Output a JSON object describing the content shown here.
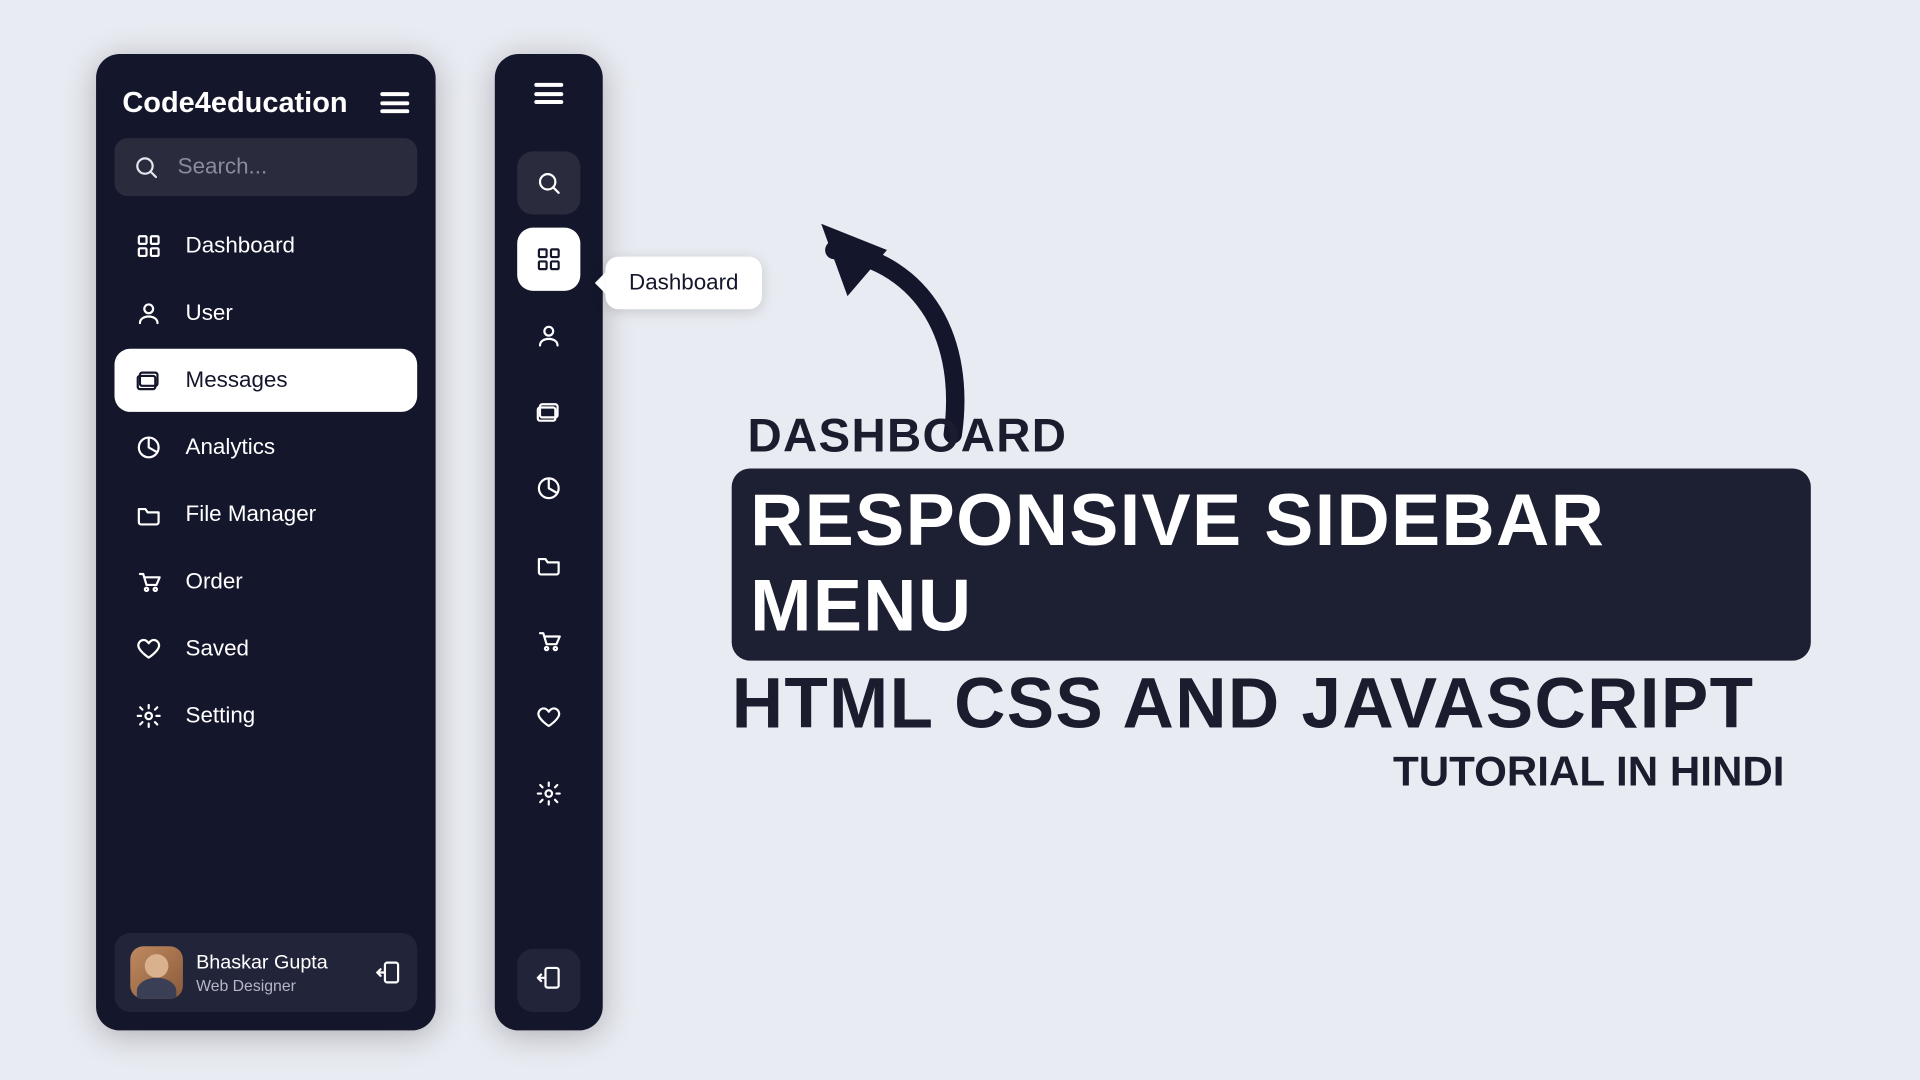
{
  "brand": "Code4education",
  "search": {
    "placeholder": "Search..."
  },
  "nav": {
    "items": [
      {
        "id": "dashboard",
        "label": "Dashboard"
      },
      {
        "id": "user",
        "label": "User"
      },
      {
        "id": "messages",
        "label": "Messages"
      },
      {
        "id": "analytics",
        "label": "Analytics"
      },
      {
        "id": "filemanager",
        "label": "File Manager"
      },
      {
        "id": "order",
        "label": "Order"
      },
      {
        "id": "saved",
        "label": "Saved"
      },
      {
        "id": "setting",
        "label": "Setting"
      }
    ],
    "active_expanded": "messages",
    "active_collapsed": "dashboard"
  },
  "tooltip": {
    "label": "Dashboard"
  },
  "user": {
    "name": "Bhaskar Gupta",
    "role": "Web Designer"
  },
  "headline": {
    "kicker": "DASHBOARD",
    "pill": "RESPONSIVE SIDEBAR MENU",
    "sub": "HTML CSS AND JAVASCRIPT",
    "tag": "TUTORIAL IN HINDI"
  },
  "colors": {
    "bg": "#e9ebf2",
    "panel": "#14162b",
    "accent": "#ffffff"
  }
}
